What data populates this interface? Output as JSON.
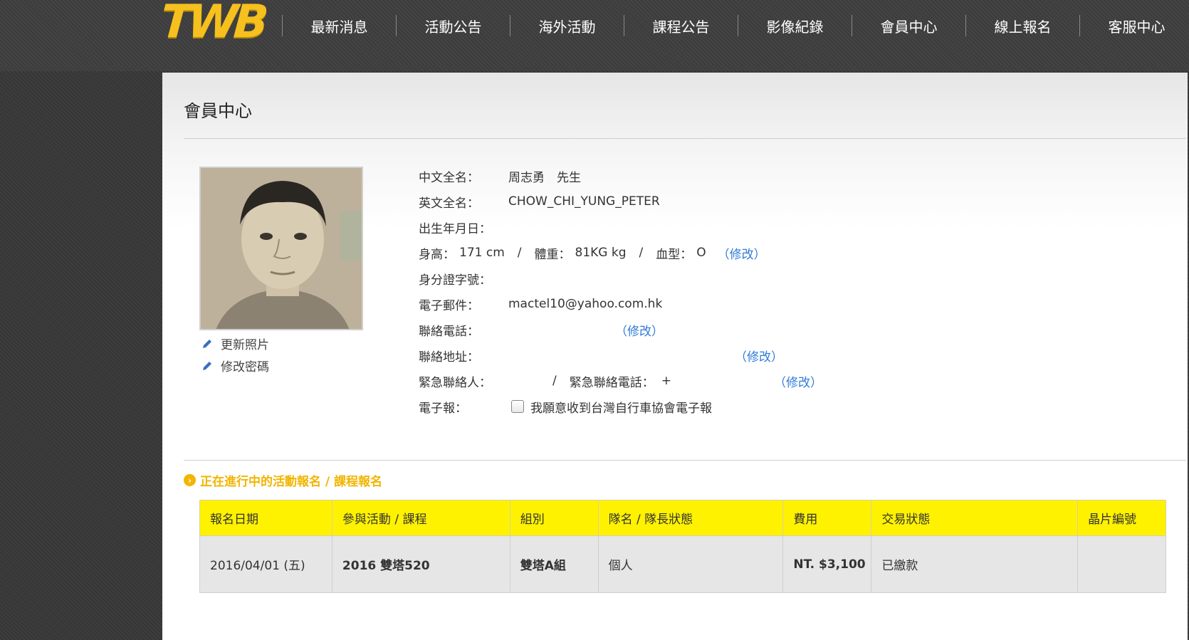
{
  "header": {
    "logo": "TWB",
    "nav": [
      "最新消息",
      "活動公告",
      "海外活動",
      "課程公告",
      "影像紀錄",
      "會員中心",
      "線上報名",
      "客服中心"
    ]
  },
  "page": {
    "title": "會員中心"
  },
  "photo_links": {
    "update_photo": "更新照片",
    "change_password": "修改密碼"
  },
  "profile": {
    "chinese_name_label": "中文全名：",
    "chinese_name": "周志勇　先生",
    "english_name_label": "英文全名：",
    "english_name": "CHOW_CHI_YUNG_PETER",
    "birth_label": "出生年月日：",
    "height_label": "身高：",
    "height": "171 cm",
    "sep1": "/",
    "weight_label": "體重：",
    "weight": "81KG kg",
    "sep2": "/",
    "blood_label": "血型：",
    "blood": "O",
    "id_label": "身分證字號：",
    "email_label": "電子郵件：",
    "email": "mactel10@yahoo.com.hk",
    "phone_label": "聯絡電話：",
    "address_label": "聯絡地址：",
    "emergency_label": "緊急聯絡人：",
    "emergency_sep": "/",
    "emergency_phone_label": "緊急聯絡電話：",
    "emergency_phone": "+",
    "newsletter_label": "電子報：",
    "newsletter_text": "我願意收到台灣自行車協會電子報",
    "edit": "（修改）"
  },
  "section": {
    "title": "正在進行中的活動報名 / 課程報名"
  },
  "table": {
    "headers": [
      "報名日期",
      "參與活動 / 課程",
      "組別",
      "隊名 / 隊長狀態",
      "費用",
      "交易狀態",
      "晶片編號"
    ],
    "rows": [
      [
        "2016/04/01 (五)",
        "2016 雙塔520",
        "雙塔A組",
        "個人",
        "NT. $3,100",
        "已繳款",
        ""
      ]
    ]
  }
}
